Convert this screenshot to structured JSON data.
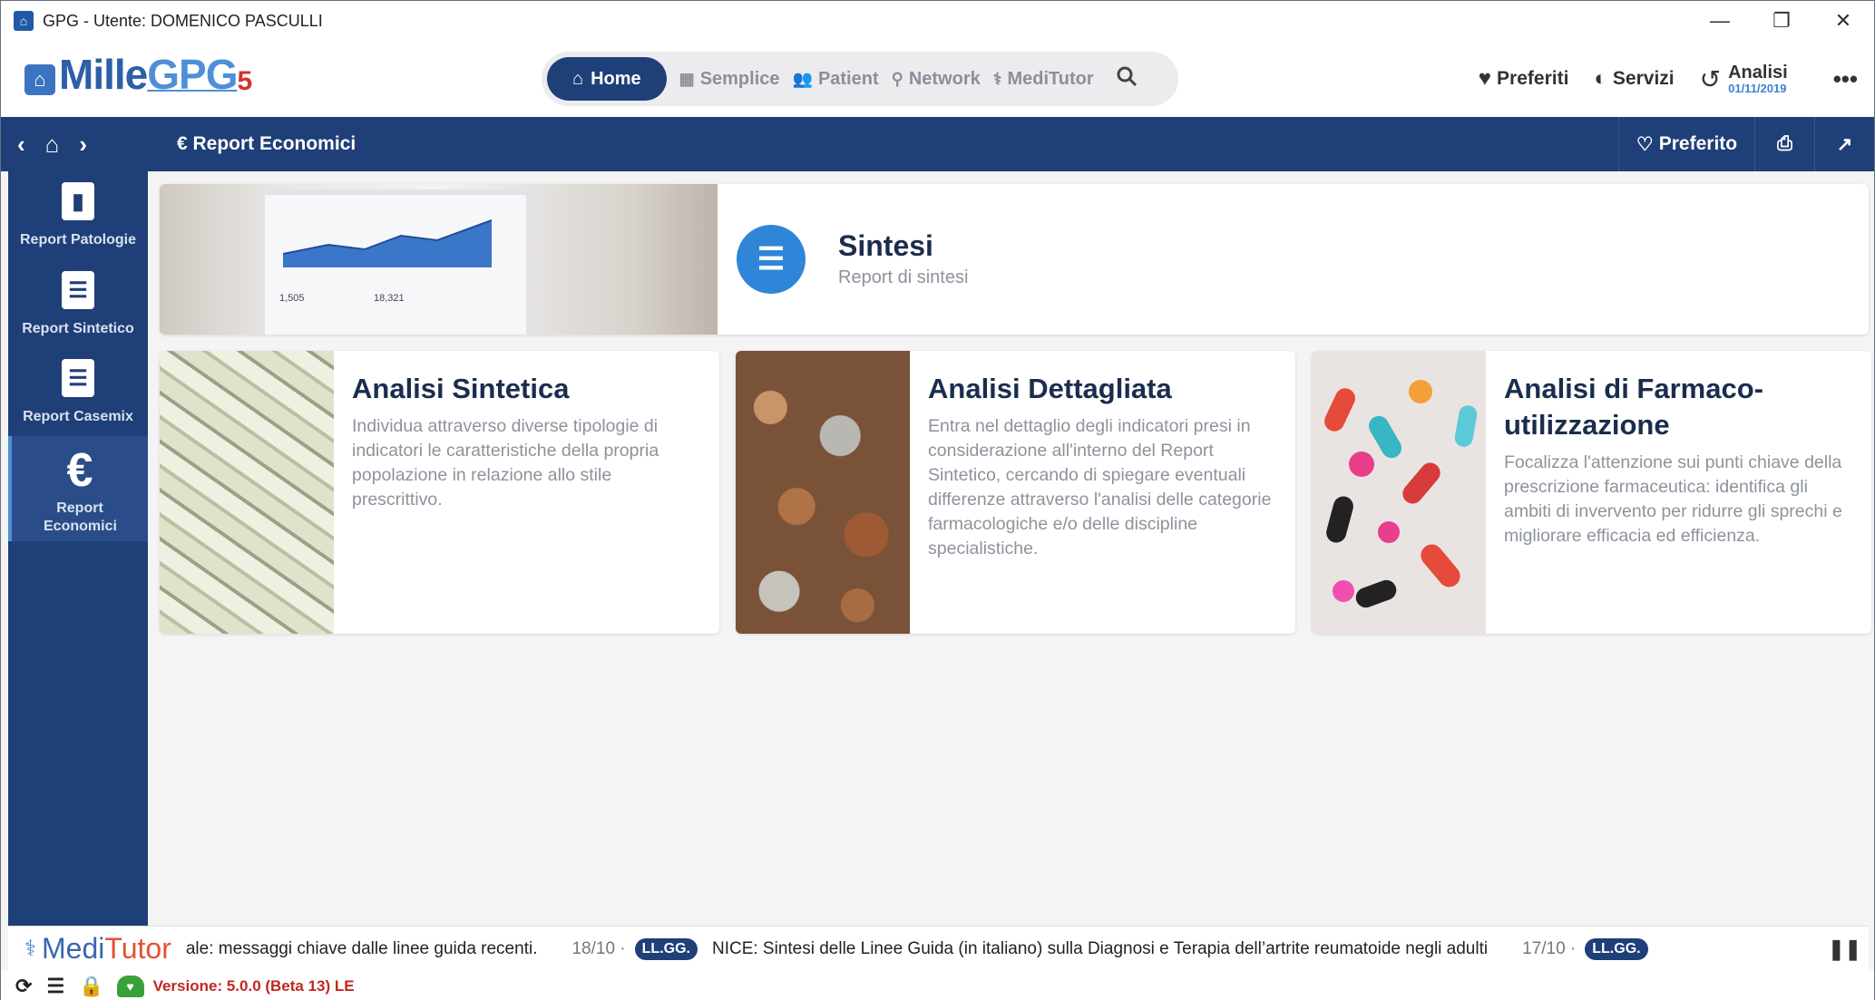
{
  "window": {
    "title": "GPG - Utente: DOMENICO PASCULLI",
    "controls": [
      "—",
      "❐",
      "✕"
    ]
  },
  "logo": {
    "part1": "Mille",
    "part2": "GPG",
    "part3": "5"
  },
  "nav": {
    "home": "Home",
    "semplice": "Semplice",
    "patient": "Patient",
    "network": "Network",
    "meditutor": "MediTutor"
  },
  "header_right": {
    "preferiti": "Preferiti",
    "servizi": "Servizi",
    "analisi": "Analisi",
    "analisi_date": "01/11/2019",
    "more": "•••"
  },
  "subbar": {
    "breadcrumb": "€ Report Economici",
    "preferito": "Preferito"
  },
  "sidebar": {
    "items": [
      {
        "label": "Report Patologie",
        "icon": "book-icon"
      },
      {
        "label": "Report Sintetico",
        "icon": "clipboard-icon"
      },
      {
        "label": "Report Casemix",
        "icon": "clipboard-icon"
      },
      {
        "label": "Report Economici",
        "icon": "euro-icon",
        "active": true
      }
    ]
  },
  "sintesi": {
    "title": "Sintesi",
    "subtitle": "Report di sintesi",
    "tablet_num1": "1,505",
    "tablet_num2": "18,321"
  },
  "cards": [
    {
      "title": "Analisi Sintetica",
      "description": "Individua attraverso diverse tipologie di indicatori le caratteristiche della propria popolazione in relazione allo stile prescrittivo."
    },
    {
      "title": "Analisi Dettagliata",
      "description": "Entra nel dettaglio degli indicatori presi in considerazione all'interno del Report Sintetico, cercando di spiegare eventuali differenze attraverso l'analisi delle categorie farmacologiche e/o delle discipline specialistiche."
    },
    {
      "title": "Analisi di Farmaco-utilizzazione",
      "description": "Focalizza l'attenzione sui punti chiave della prescrizione farmaceutica: identifica gli ambiti di invervento per ridurre gli sprechi e migliorare efficacia ed efficienza."
    }
  ],
  "ticker": {
    "brand_medi": "Medi",
    "brand_tutor": "Tutor",
    "msg1": "ale: messaggi chiave dalle linee guida recenti.",
    "date1": "18/10 ·",
    "tag1": "LL.GG.",
    "msg2": "NICE: Sintesi delle Linee Guida (in italiano) sulla Diagnosi e Terapia dell’artrite reumatoide negli adulti",
    "date2": "17/10 ·",
    "tag2": "LL.GG."
  },
  "status": {
    "version": "Versione: 5.0.0 (Beta 13) LE"
  },
  "colors": {
    "navy": "#1f3f78",
    "accent_blue": "#2f86d8",
    "version_red": "#c0281f"
  }
}
